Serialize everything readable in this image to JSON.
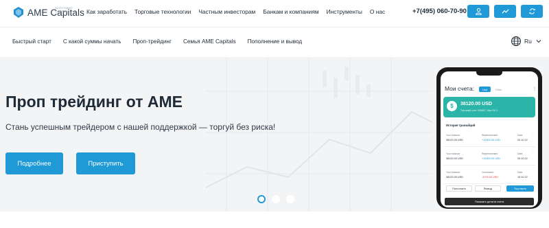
{
  "header": {
    "logo_text": "AME Capitals",
    "logo_small": "INVESTMENT COMPANY",
    "nav": [
      "Как заработать",
      "Торговые технологии",
      "Частным инвесторам",
      "Банкам и компаниям",
      "Инструменты",
      "О нас"
    ],
    "phone": "+7(495) 060-70-90",
    "icons": [
      "user-icon",
      "chart-icon",
      "exchange-icon"
    ]
  },
  "subnav": {
    "items": [
      "Быстрый старт",
      "С какой суммы начать",
      "Проп-трейдинг",
      "Семья AME Capitals",
      "Пополнение и вывод"
    ],
    "language": "Ru"
  },
  "hero": {
    "title": "Проп трейдинг от AME",
    "subtitle": "Стань успешным трейдером с нашей поддержкой — торгуй без риска!",
    "btn_more": "Подробнее",
    "btn_start": "Приступить",
    "slides": 3,
    "active_slide": 1
  },
  "phone": {
    "title": "Мои счета:",
    "tab_usd": "Usd",
    "tab_other": "Other",
    "card_amount": "38120.00 USD",
    "card_sub": "Торговый счет: 305897, Max RU 2",
    "history_title": "История транзакций",
    "transactions": [
      {
        "c1_label": "Your balance",
        "c1_value": "38120.00 USD",
        "c2_label": "Replenishment",
        "c2_value": "+10000.00 USD",
        "c2_type": "pos",
        "c3_label": "Date",
        "c3_value": "20.10.22"
      },
      {
        "c1_label": "Your balance",
        "c1_value": "38120.00 USD",
        "c2_label": "Replenishment",
        "c2_value": "+10000.00 USD",
        "c2_type": "pos",
        "c3_label": "Date",
        "c3_value": "20.10.22"
      },
      {
        "c1_label": "Your balance",
        "c1_value": "38120.00 USD",
        "c2_label": "Conclusion",
        "c2_value": "-4700.00 USD",
        "c2_type": "neg",
        "c3_label": "Date",
        "c3_value": "19.10.22"
      }
    ],
    "btn_deposit": "Пополнить",
    "btn_withdraw": "Вывод",
    "btn_trade": "Торговать",
    "show_details": "Показать детали счета"
  },
  "colors": {
    "accent": "#1f9ad6",
    "card": "#2bb5a8",
    "text": "#1e2a36",
    "hero_bg": "#f3f4f6"
  }
}
